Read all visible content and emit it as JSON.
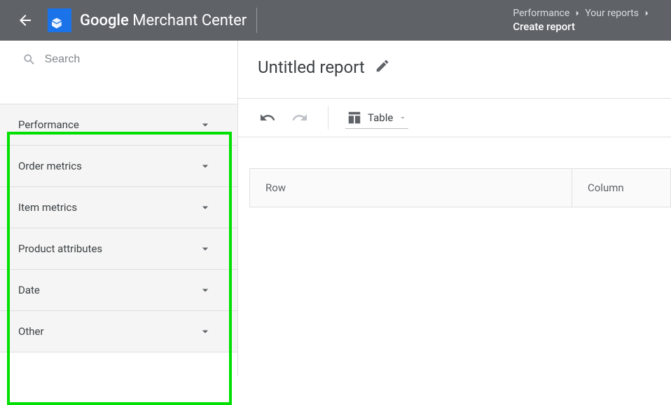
{
  "header": {
    "brand_google": "Google",
    "brand_rest": " Merchant Center",
    "breadcrumb": {
      "level1": "Performance",
      "level2": "Your reports",
      "current": "Create report"
    }
  },
  "sidebar": {
    "search_placeholder": "Search",
    "groups": [
      {
        "label": "Performance"
      },
      {
        "label": "Order metrics"
      },
      {
        "label": "Item metrics"
      },
      {
        "label": "Product attributes"
      },
      {
        "label": "Date"
      },
      {
        "label": "Other"
      }
    ]
  },
  "main": {
    "report_title": "Untitled report",
    "view_label": "Table",
    "columns": {
      "row_header": "Row",
      "col_header": "Column"
    }
  }
}
